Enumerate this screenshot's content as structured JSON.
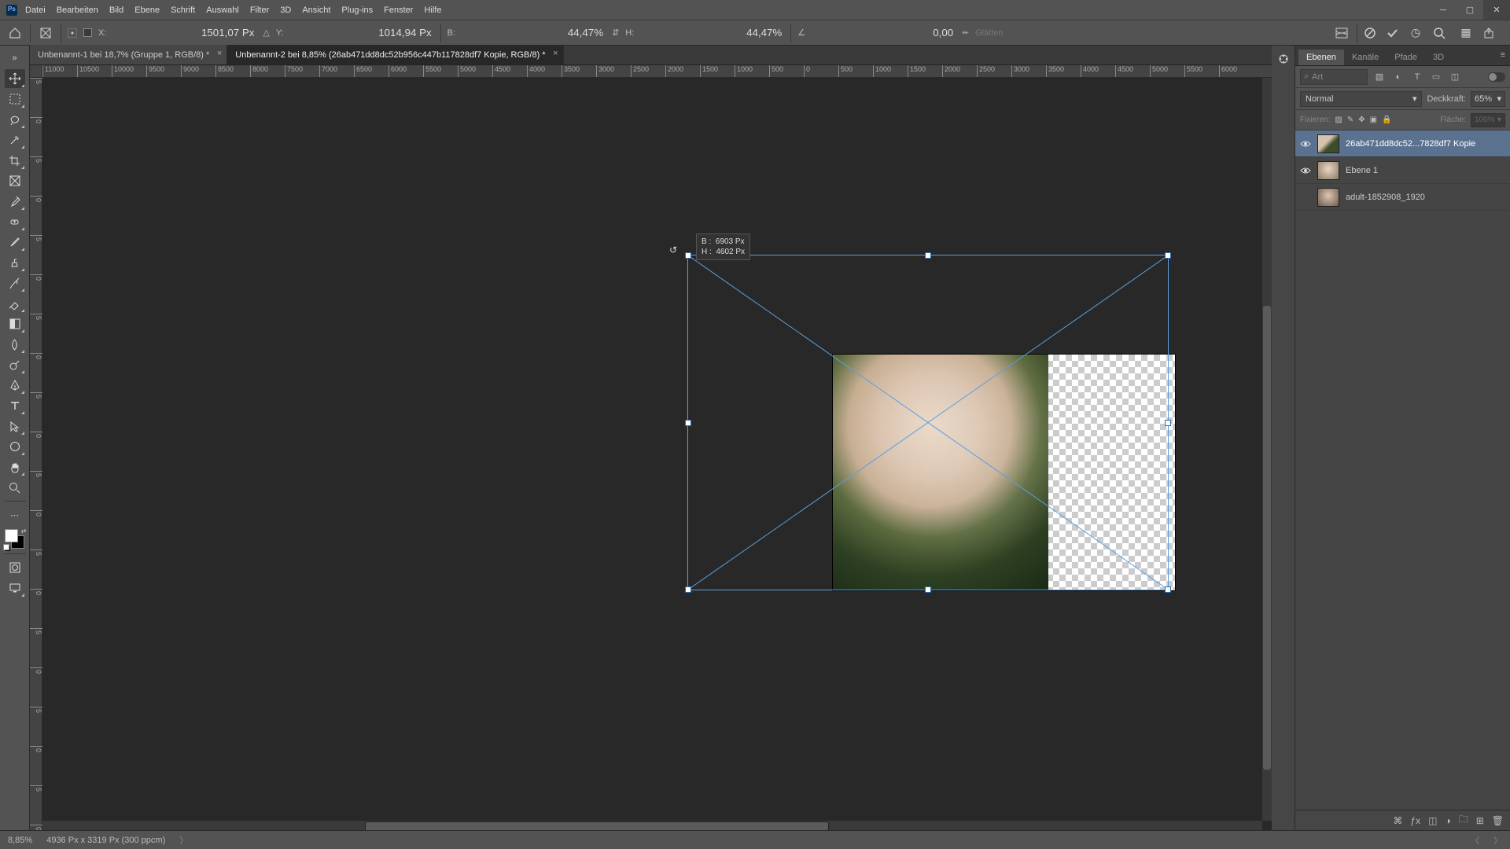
{
  "menu": [
    "Datei",
    "Bearbeiten",
    "Bild",
    "Ebene",
    "Schrift",
    "Auswahl",
    "Filter",
    "3D",
    "Ansicht",
    "Plug-ins",
    "Fenster",
    "Hilfe"
  ],
  "options": {
    "x_label": "X:",
    "x_value": "1501,07 Px",
    "y_label": "Y:",
    "y_value": "1014,94 Px",
    "w_label": "B:",
    "w_value": "44,47%",
    "h_label": "H:",
    "h_value": "44,47%",
    "angle_value": "0,00",
    "skew_value": "",
    "flatten_label": "Glätten"
  },
  "tabs": [
    {
      "title": "Unbenannt-1 bei 18,7% (Gruppe 1, RGB/8) *",
      "active": false
    },
    {
      "title": "Unbenannt-2 bei 8,85% (26ab471dd8dc52b956c447b117828df7 Kopie, RGB/8) *",
      "active": true
    }
  ],
  "ruler_h": [
    "11000",
    "10500",
    "10000",
    "9500",
    "9000",
    "8500",
    "8000",
    "7500",
    "7000",
    "6500",
    "6000",
    "5500",
    "5000",
    "4500",
    "4000",
    "3500",
    "3000",
    "2500",
    "2000",
    "1500",
    "1000",
    "500",
    "0",
    "500",
    "1000",
    "1500",
    "2000",
    "2500",
    "3000",
    "3500",
    "4000",
    "4500",
    "5000",
    "5500",
    "6000"
  ],
  "ruler_v": [
    "5",
    "0",
    "5",
    "0",
    "5",
    "0",
    "5",
    "0",
    "5",
    "0",
    "5",
    "0",
    "5",
    "0",
    "5",
    "0",
    "5",
    "0",
    "5",
    "0"
  ],
  "dim_tooltip": {
    "w_label": "B :",
    "w_value": "6903 Px",
    "h_label": "H :",
    "h_value": "4602 Px"
  },
  "panel_tabs": [
    "Ebenen",
    "Kanäle",
    "Pfade",
    "3D"
  ],
  "filter_placeholder": "Art",
  "blend_mode": "Normal",
  "opacity_label": "Deckkraft:",
  "opacity_value": "65%",
  "lock_label": "Fixieren:",
  "fill_label": "Fläche:",
  "fill_value": "100%",
  "layers": [
    {
      "name": "26ab471dd8dc52...7828df7 Kopie",
      "visible": true,
      "selected": true,
      "thumb": "t1"
    },
    {
      "name": "Ebene 1",
      "visible": true,
      "selected": false,
      "thumb": "t2"
    },
    {
      "name": "adult-1852908_1920",
      "visible": false,
      "selected": false,
      "thumb": "t3"
    }
  ],
  "status": {
    "zoom": "8,85%",
    "info": "4936 Px x 3319 Px (300 ppcm)"
  }
}
